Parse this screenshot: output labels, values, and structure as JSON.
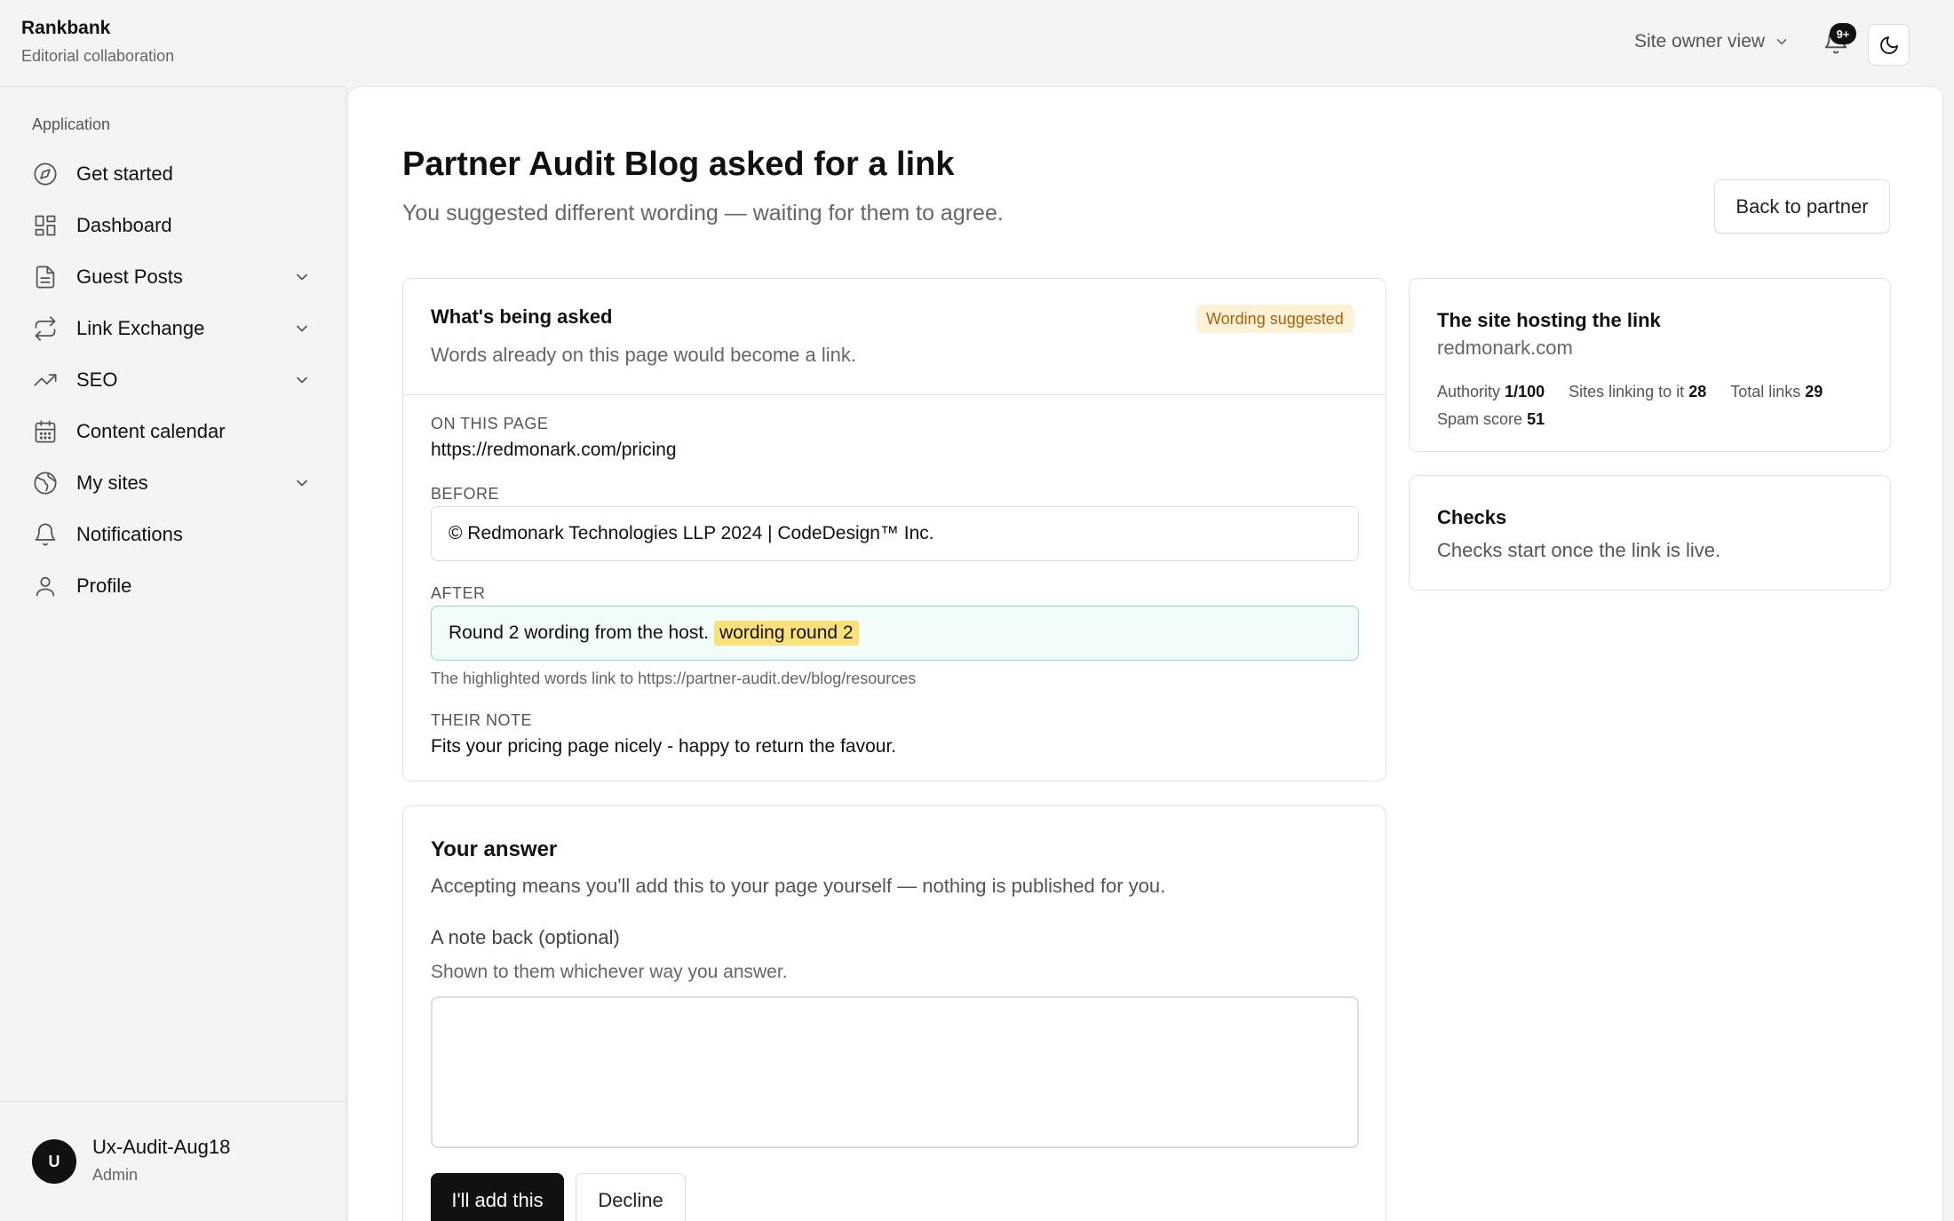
{
  "app": {
    "name": "Rankbank",
    "subtitle": "Editorial collaboration"
  },
  "header": {
    "view_switch": "Site owner view",
    "notification_badge": "9+"
  },
  "sidebar": {
    "section": "Application",
    "items": [
      {
        "label": "Get started",
        "icon": "compass-icon",
        "expandable": false
      },
      {
        "label": "Dashboard",
        "icon": "dashboard-grid-icon",
        "expandable": false
      },
      {
        "label": "Guest Posts",
        "icon": "document-icon",
        "expandable": true
      },
      {
        "label": "Link Exchange",
        "icon": "repeat-icon",
        "expandable": true
      },
      {
        "label": "SEO",
        "icon": "trending-up-icon",
        "expandable": true
      },
      {
        "label": "Content calendar",
        "icon": "calendar-icon",
        "expandable": false
      },
      {
        "label": "My sites",
        "icon": "globe-icon",
        "expandable": true
      },
      {
        "label": "Notifications",
        "icon": "bell-icon",
        "expandable": false
      },
      {
        "label": "Profile",
        "icon": "user-icon",
        "expandable": false
      }
    ],
    "user": {
      "initial": "U",
      "name": "Ux-Audit-Aug18",
      "role": "Admin"
    }
  },
  "page": {
    "title": "Partner Audit Blog asked for a link",
    "subtitle": "You suggested different wording — waiting for them to agree.",
    "back_button": "Back to partner"
  },
  "request": {
    "title": "What's being asked",
    "badge": "Wording suggested",
    "description": "Words already on this page would become a link.",
    "page_label": "ON THIS PAGE",
    "page_url": "https://redmonark.com/pricing",
    "before_label": "BEFORE",
    "before_text": "© Redmonark Technologies LLP 2024 | CodeDesign™ Inc.",
    "after_label": "AFTER",
    "after_text": "Round 2 wording from the host.",
    "after_highlight": "wording round 2",
    "link_hint": "The highlighted words link to https://partner-audit.dev/blog/resources",
    "note_label": "THEIR NOTE",
    "note_text": "Fits your pricing page nicely - happy to return the favour."
  },
  "answer": {
    "title": "Your answer",
    "description": "Accepting means you'll add this to your page yourself — nothing is published for you.",
    "note_label": "A note back (optional)",
    "note_hint": "Shown to them whichever way you answer.",
    "note_value": "",
    "accept_button": "I'll add this",
    "decline_button": "Decline"
  },
  "host_site": {
    "title": "The site hosting the link",
    "domain": "redmonark.com",
    "authority_label": "Authority",
    "authority_value": "1/100",
    "linking_label": "Sites linking to it",
    "linking_value": "28",
    "total_label": "Total links",
    "total_value": "29",
    "spam_label": "Spam score",
    "spam_value": "51"
  },
  "checks": {
    "title": "Checks",
    "text": "Checks start once the link is live."
  }
}
